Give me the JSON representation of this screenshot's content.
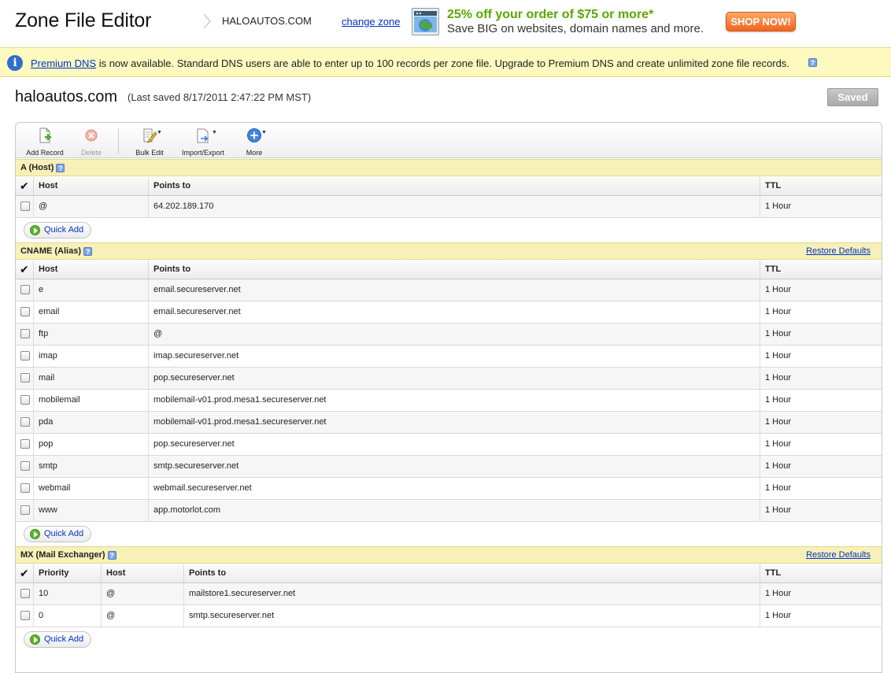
{
  "header": {
    "title": "Zone File Editor",
    "zone": "HALOAUTOS.COM",
    "change_zone": "change zone",
    "promo_line1": "25% off your order of $75 or more*",
    "promo_line2": "Save BIG on websites, domain names and more.",
    "shop_now": "SHOP NOW!"
  },
  "banner": {
    "link": "Premium DNS",
    "text": " is now available. Standard DNS users are able to enter up to 100 records per zone file. Upgrade to Premium DNS and create unlimited zone file records.",
    "help": "?"
  },
  "domain": {
    "name": "haloautos.com",
    "last_saved": "(Last saved 8/17/2011 2:47:22 PM MST)",
    "saved_button": "Saved"
  },
  "toolbar": {
    "add_record": "Add Record",
    "delete": "Delete",
    "bulk_edit": "Bulk Edit",
    "import_export": "Import/Export",
    "more": "More"
  },
  "sections": {
    "a": {
      "title": "A (Host)",
      "help": "?",
      "columns": [
        "Host",
        "Points to",
        "TTL"
      ],
      "rows": [
        {
          "host": "@",
          "points_to": "64.202.189.170",
          "ttl": "1 Hour"
        }
      ],
      "quick_add": "Quick Add"
    },
    "cname": {
      "title": "CNAME (Alias)",
      "help": "?",
      "restore": "Restore Defaults",
      "columns": [
        "Host",
        "Points to",
        "TTL"
      ],
      "rows": [
        {
          "host": "e",
          "points_to": "email.secureserver.net",
          "ttl": "1 Hour"
        },
        {
          "host": "email",
          "points_to": "email.secureserver.net",
          "ttl": "1 Hour"
        },
        {
          "host": "ftp",
          "points_to": "@",
          "ttl": "1 Hour"
        },
        {
          "host": "imap",
          "points_to": "imap.secureserver.net",
          "ttl": "1 Hour"
        },
        {
          "host": "mail",
          "points_to": "pop.secureserver.net",
          "ttl": "1 Hour"
        },
        {
          "host": "mobilemail",
          "points_to": "mobilemail-v01.prod.mesa1.secureserver.net",
          "ttl": "1 Hour"
        },
        {
          "host": "pda",
          "points_to": "mobilemail-v01.prod.mesa1.secureserver.net",
          "ttl": "1 Hour"
        },
        {
          "host": "pop",
          "points_to": "pop.secureserver.net",
          "ttl": "1 Hour"
        },
        {
          "host": "smtp",
          "points_to": "smtp.secureserver.net",
          "ttl": "1 Hour"
        },
        {
          "host": "webmail",
          "points_to": "webmail.secureserver.net",
          "ttl": "1 Hour"
        },
        {
          "host": "www",
          "points_to": "app.motorlot.com",
          "ttl": "1 Hour"
        }
      ],
      "quick_add": "Quick Add"
    },
    "mx": {
      "title": "MX (Mail Exchanger)",
      "help": "?",
      "restore": "Restore Defaults",
      "columns": [
        "Priority",
        "Host",
        "Points to",
        "TTL"
      ],
      "rows": [
        {
          "priority": "10",
          "host": "@",
          "points_to": "mailstore1.secureserver.net",
          "ttl": "1 Hour"
        },
        {
          "priority": "0",
          "host": "@",
          "points_to": "smtp.secureserver.net",
          "ttl": "1 Hour"
        }
      ],
      "quick_add": "Quick Add"
    }
  }
}
